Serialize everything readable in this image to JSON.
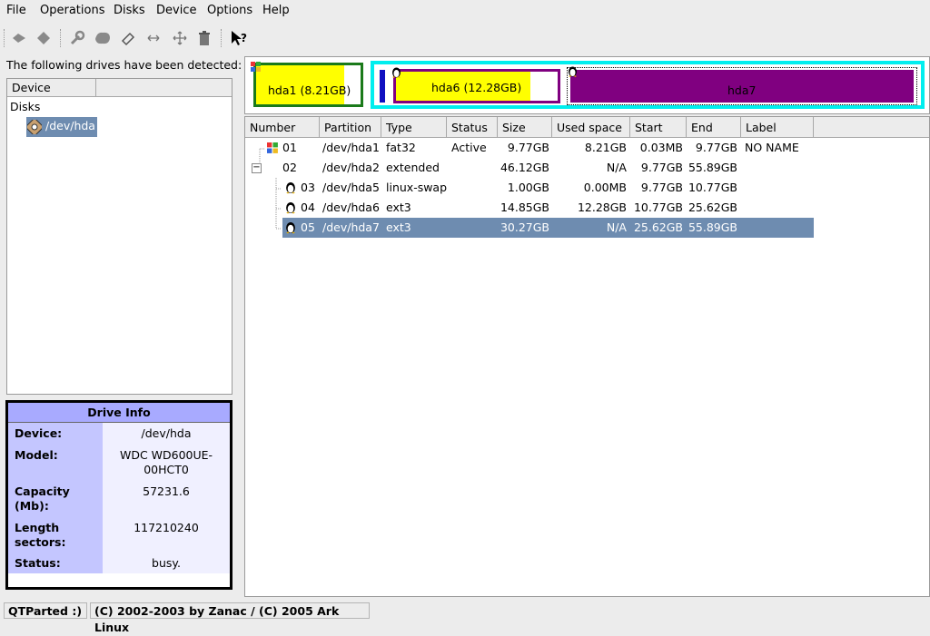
{
  "menu": [
    "File",
    "Operations",
    "Disks",
    "Device",
    "Options",
    "Help"
  ],
  "toolbar": {
    "icons": [
      "undo-icon",
      "commit-icon",
      "properties-icon",
      "format-icon",
      "erase-icon",
      "resize-icon",
      "move-icon",
      "delete-icon",
      "whats-this-icon"
    ]
  },
  "left": {
    "detected_label": "The following drives have been detected:",
    "tree_header": "Device",
    "tree_root": "Disks",
    "tree_drive": "/dev/hda"
  },
  "drive_info": {
    "title": "Drive Info",
    "rows": [
      {
        "label": "Device:",
        "value": "/dev/hda"
      },
      {
        "label": "Model:",
        "value": "WDC WD600UE-00HCT0"
      },
      {
        "label": "Capacity (Mb):",
        "value": "57231.6"
      },
      {
        "label": "Length sectors:",
        "value": "117210240"
      },
      {
        "label": "Status:",
        "value": "busy."
      }
    ]
  },
  "disk_map": {
    "hda1": {
      "label": "hda1 (8.21GB)",
      "used_fraction": 0.84
    },
    "hda6": {
      "label": "hda6 (12.28GB)",
      "used_fraction": 0.83
    },
    "hda7": {
      "label": "hda7"
    },
    "colors": {
      "fat32_border": "#1a7a1a",
      "extended_border": "#00eeee",
      "used_fill": "#ffff00",
      "ext3": "#800080",
      "swap": "#1010c0"
    }
  },
  "table": {
    "columns": [
      "Number",
      "Partition",
      "Type",
      "Status",
      "Size",
      "Used space",
      "Start",
      "End",
      "Label"
    ],
    "rows": [
      {
        "number": "01",
        "partition": "/dev/hda1",
        "type": "fat32",
        "status": "Active",
        "size": "9.77GB",
        "used": "8.21GB",
        "start": "0.03MB",
        "end": "9.77GB",
        "label": "NO NAME",
        "icon": "windows-icon"
      },
      {
        "number": "02",
        "partition": "/dev/hda2",
        "type": "extended",
        "status": "",
        "size": "46.12GB",
        "used": "N/A",
        "start": "9.77GB",
        "end": "55.89GB",
        "label": "",
        "icon": "collapse-icon"
      },
      {
        "number": "03",
        "partition": "/dev/hda5",
        "type": "linux-swap",
        "status": "",
        "size": "1.00GB",
        "used": "0.00MB",
        "start": "9.77GB",
        "end": "10.77GB",
        "label": "",
        "icon": "tux-icon"
      },
      {
        "number": "04",
        "partition": "/dev/hda6",
        "type": "ext3",
        "status": "",
        "size": "14.85GB",
        "used": "12.28GB",
        "start": "10.77GB",
        "end": "25.62GB",
        "label": "",
        "icon": "tux-icon"
      },
      {
        "number": "05",
        "partition": "/dev/hda7",
        "type": "ext3",
        "status": "",
        "size": "30.27GB",
        "used": "N/A",
        "start": "25.62GB",
        "end": "55.89GB",
        "label": "",
        "icon": "tux-icon"
      }
    ]
  },
  "statusbar": {
    "app": "QTParted :)",
    "copyright": "(C) 2002-2003 by Zanac / (C) 2005 Ark Linux"
  }
}
